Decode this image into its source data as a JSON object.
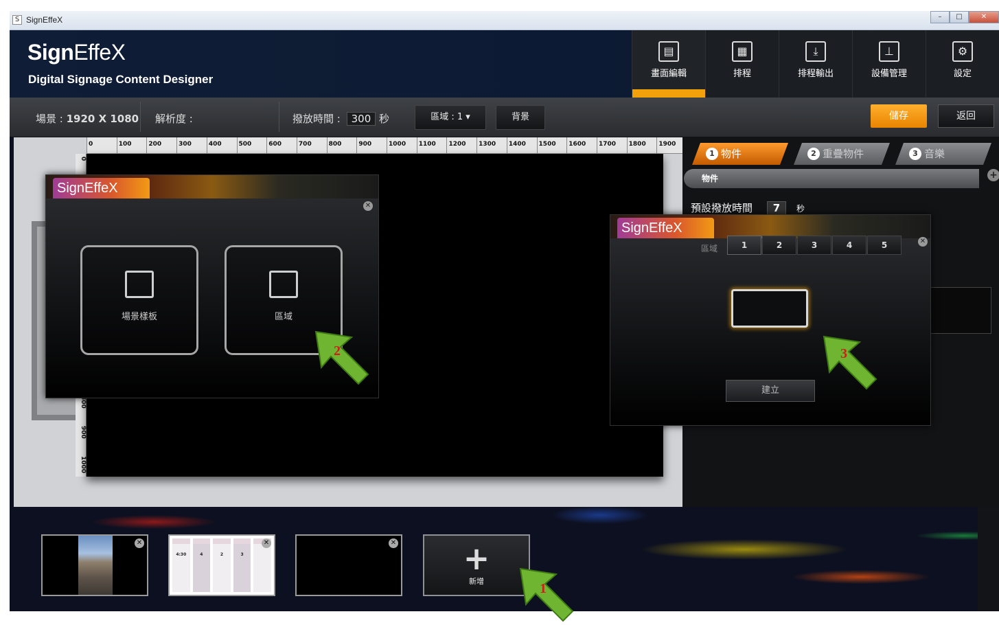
{
  "window": {
    "title": "SignEffeX",
    "app_icon": "S",
    "minimize": "–",
    "maximize": "□",
    "close": "✕"
  },
  "header": {
    "brand_sign": "Sign",
    "brand_effex": "EffeX",
    "subtitle": "Digital Signage Content Designer",
    "nav": [
      {
        "label": "畫面編輯",
        "icon": "screen-edit-icon",
        "active": true
      },
      {
        "label": "排程",
        "icon": "calendar-icon"
      },
      {
        "label": "排程輸出",
        "icon": "export-icon"
      },
      {
        "label": "設備管理",
        "icon": "device-icon"
      },
      {
        "label": "設定",
        "icon": "gear-icon"
      }
    ]
  },
  "toolbar": {
    "scene_label": "場景 :",
    "scene_value": "1920 X 1080",
    "resolution_label": "解析度 :",
    "playtime_label": "撥放時間 :",
    "playtime_value": "300",
    "playtime_unit": "秒",
    "region_btn": "區域 : 1 ▾",
    "bg_btn": "背景",
    "save_btn": "儲存",
    "back_btn": "返回"
  },
  "ruler": {
    "top": [
      "0",
      "100",
      "200",
      "300",
      "400",
      "500",
      "600",
      "700",
      "800",
      "900",
      "1000",
      "1100",
      "1200",
      "1300",
      "1400",
      "1500",
      "1600",
      "1700",
      "1800",
      "1900"
    ],
    "left": [
      "0",
      "800",
      "900",
      "1000"
    ]
  },
  "right_panel": {
    "tabs": [
      {
        "num": "1",
        "label": "物件",
        "active": true
      },
      {
        "num": "2",
        "label": "重疊物件"
      },
      {
        "num": "3",
        "label": "音樂"
      }
    ],
    "section_title": "物件",
    "plus": "+",
    "default_time_label": "預設撥放時間",
    "default_time_value": "7",
    "default_time_unit": "秒"
  },
  "dialog_add": {
    "logo": "SignEffeX",
    "close": "✕",
    "options": [
      {
        "label": "場景樣板",
        "icon": "template-icon"
      },
      {
        "label": "區域",
        "icon": "region-layout-icon"
      }
    ]
  },
  "dialog_region": {
    "logo": "SignEffeX",
    "close": "✕",
    "region_label": "區域",
    "region_tabs": [
      "1",
      "2",
      "3",
      "4",
      "5"
    ],
    "selected_tab": "1",
    "create_btn": "建立"
  },
  "annotations": [
    "1",
    "2",
    "3"
  ],
  "thumbnails": {
    "list_items": [
      "4:30",
      "4",
      "2",
      "3"
    ],
    "add_label": "新增",
    "add_symbol": "+",
    "remove": "✕"
  }
}
